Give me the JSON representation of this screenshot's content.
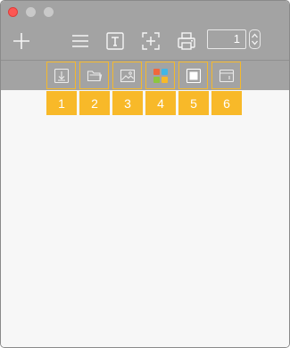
{
  "window": {
    "traffic_lights": [
      "close",
      "minimize",
      "zoom"
    ]
  },
  "toolbar": {
    "icons": [
      "add-icon",
      "list-icon",
      "text-icon",
      "fit-to-page-icon",
      "print-icon"
    ],
    "page_stepper": {
      "value": "1"
    }
  },
  "sub_toolbar": {
    "buttons": [
      {
        "icon": "import-icon",
        "badge": "1"
      },
      {
        "icon": "folder-icon",
        "badge": "2"
      },
      {
        "icon": "image-icon",
        "badge": "3"
      },
      {
        "icon": "color-grid-icon",
        "badge": "4"
      },
      {
        "icon": "frame-icon",
        "badge": "5"
      },
      {
        "icon": "window-icon",
        "badge": "6"
      }
    ],
    "highlight_color": "#f8b929"
  }
}
